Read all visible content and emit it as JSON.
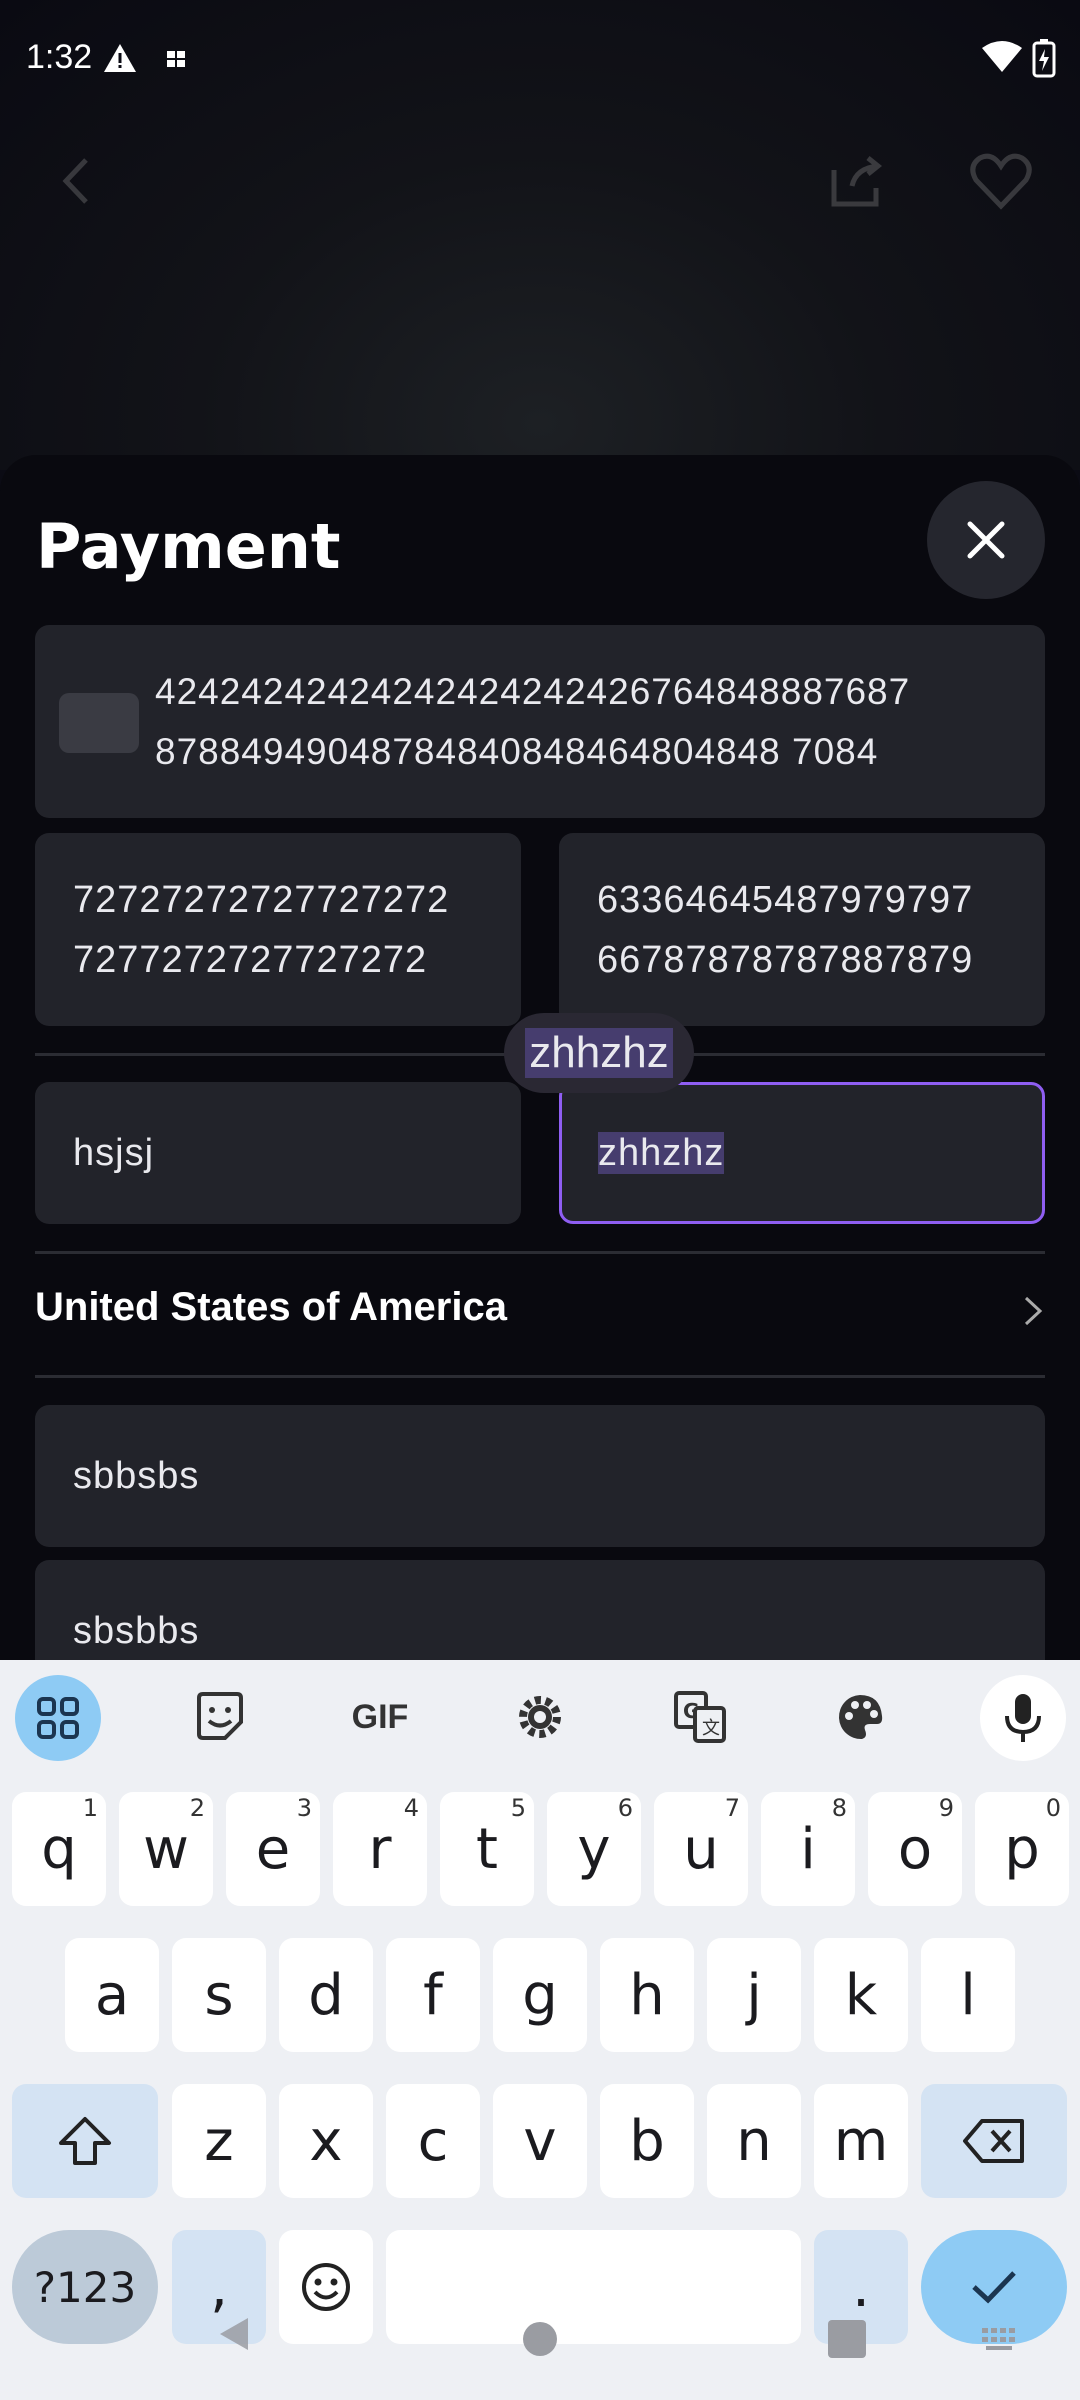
{
  "status_bar": {
    "time": "1:32"
  },
  "sheet": {
    "title": "Payment",
    "card_number": "42424242424242424242426764848887687\n87884949048784840848464804848 7084",
    "expiry": "72727272727727272\n7277272727727272",
    "cvc": "63364645487979797\n66787878787887879",
    "first_name": "hsjsj",
    "last_name": "zhhzhz",
    "selection_popup": "zhhzhz",
    "country": "United States of America",
    "address_line1": "sbbsbs",
    "address_line2": "sbsbbs"
  },
  "keyboard": {
    "toolbar": [
      "apps-grid-icon",
      "sticker-icon",
      "GIF",
      "settings-icon",
      "translate-icon",
      "palette-icon",
      "mic-icon"
    ],
    "gif_label": "GIF",
    "row1": [
      {
        "k": "q",
        "n": "1"
      },
      {
        "k": "w",
        "n": "2"
      },
      {
        "k": "e",
        "n": "3"
      },
      {
        "k": "r",
        "n": "4"
      },
      {
        "k": "t",
        "n": "5"
      },
      {
        "k": "y",
        "n": "6"
      },
      {
        "k": "u",
        "n": "7"
      },
      {
        "k": "i",
        "n": "8"
      },
      {
        "k": "o",
        "n": "9"
      },
      {
        "k": "p",
        "n": "0"
      }
    ],
    "row2": [
      "a",
      "s",
      "d",
      "f",
      "g",
      "h",
      "j",
      "k",
      "l"
    ],
    "row3": [
      "z",
      "x",
      "c",
      "v",
      "b",
      "n",
      "m"
    ],
    "symbols_label": "?123",
    "comma": ",",
    "period": "."
  },
  "colors": {
    "accent": "#8f5ef2",
    "sheet_bg": "#09090f",
    "field_bg": "#22232a",
    "keyboard_bg": "#eef0f4",
    "mod_key": "#d4e3f3",
    "enter_key": "#8ecbf4"
  }
}
